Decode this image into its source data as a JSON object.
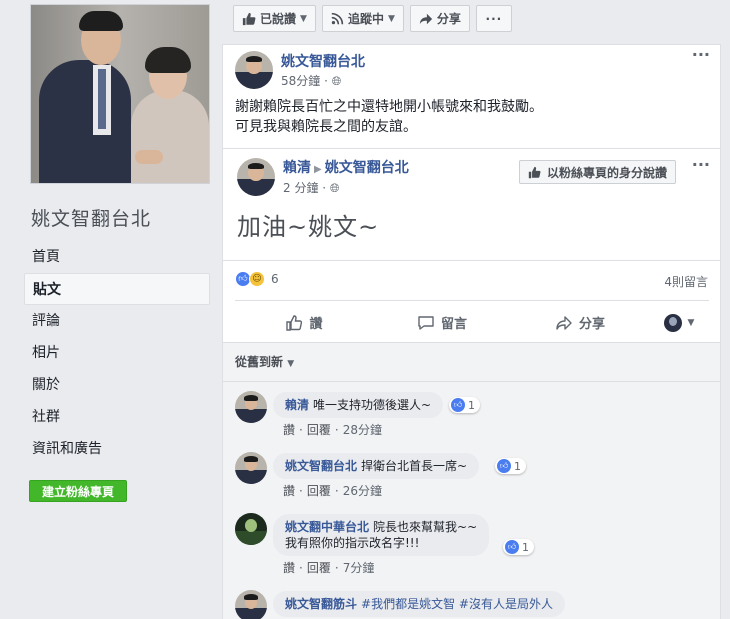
{
  "left": {
    "page_name": "姚文智翻台北",
    "nav": [
      "首頁",
      "貼文",
      "評論",
      "相片",
      "關於",
      "社群",
      "資訊和廣告"
    ],
    "create_page": "建立粉絲專頁"
  },
  "topbar": {
    "liked": "已說讚",
    "following": "追蹤中",
    "share": "分享",
    "more": "···"
  },
  "post": {
    "author": "姚文智翻台北",
    "time": "58分鐘",
    "line1": "謝謝賴院長百忙之中還特地開小帳號來和我鼓勵。",
    "line2": "可見我與賴院長之間的友誼。",
    "shared": {
      "author": "賴清",
      "target": "姚文智翻台北",
      "time": "2 分鐘",
      "as_page_button": "以粉絲專頁的身分說讚",
      "text": "加油~姚文~"
    },
    "reaction_count": "6",
    "comment_count": "4則留言",
    "actions": {
      "like": "讚",
      "comment": "留言",
      "share": "分享"
    }
  },
  "comments": {
    "sort_label": "從舊到新",
    "items": [
      {
        "name": "賴清",
        "text": "唯一支持功德後選人~",
        "reacts": "1",
        "time": "28分鐘"
      },
      {
        "name": "姚文智翻台北",
        "text": "捍衛台北首長一席~",
        "reacts": "1",
        "time": "26分鐘"
      },
      {
        "name": "姚文翻中華台北",
        "text": "院長也來幫幫我~~",
        "text2": "我有照你的指示改名字!!!",
        "reacts": "1",
        "time": "7分鐘"
      },
      {
        "name": "姚文智翻筋斗",
        "tag1": "#我們都是姚文智",
        "tag2": "#沒有人是局外人"
      }
    ],
    "like_label": "讚",
    "reply_label": "回覆"
  },
  "colors": {
    "link": "#385898",
    "like_blue": "#4a7df0",
    "green_button": "#42b72a"
  }
}
